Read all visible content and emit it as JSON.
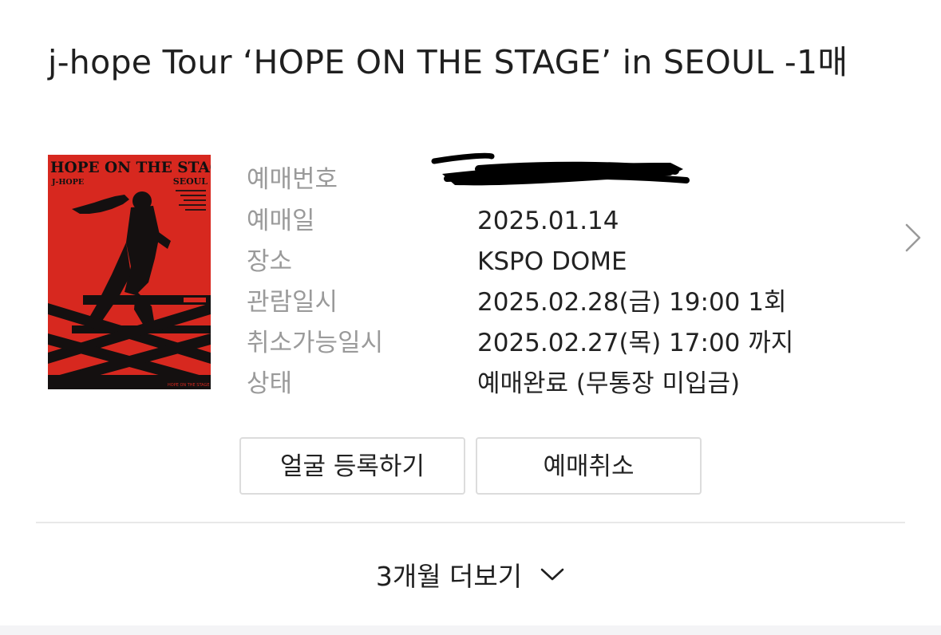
{
  "ticket": {
    "title": "j-hope Tour ‘HOPE ON THE STAGE’ in SEOUL -1매",
    "poster": {
      "headline": "HOPE ON THE STAGE",
      "artist": "J-HOPE",
      "city": "SEOUL",
      "background_color": "#d7281f"
    },
    "rows": [
      {
        "label": "예매번호",
        "value": ""
      },
      {
        "label": "예매일",
        "value": "2025.01.14"
      },
      {
        "label": "장소",
        "value": "KSPO DOME"
      },
      {
        "label": "관람일시",
        "value": "2025.02.28(금) 19:00 1회"
      },
      {
        "label": "취소가능일시",
        "value": "2025.02.27(목) 17:00 까지"
      },
      {
        "label": "상태",
        "value": "예매완료 (무통장 미입금)"
      }
    ],
    "detail_icon": "chevron-right-icon"
  },
  "actions": {
    "face_register_label": "얼굴 등록하기",
    "cancel_label": "예매취소"
  },
  "footer": {
    "more_label": "3개월 더보기",
    "more_icon": "chevron-down-icon"
  }
}
